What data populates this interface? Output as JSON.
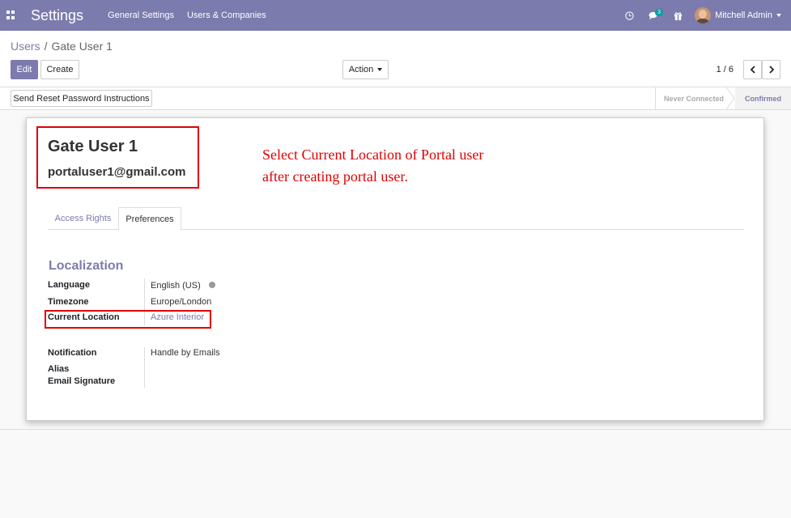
{
  "navbar": {
    "brand": "Settings",
    "menu": [
      "General Settings",
      "Users & Companies"
    ],
    "messages_badge": "3",
    "user_name": "Mitchell Admin"
  },
  "control_panel": {
    "breadcrumb_parent": "Users",
    "breadcrumb_sep": "/",
    "breadcrumb_current": "Gate User 1",
    "edit_label": "Edit",
    "create_label": "Create",
    "action_label": "Action",
    "pager": "1 / 6"
  },
  "statusbar": {
    "reset_password_label": "Send Reset Password Instructions",
    "stages": [
      "Never Connected",
      "Confirmed"
    ],
    "active_stage": "Confirmed"
  },
  "form": {
    "name": "Gate User 1",
    "login": "portaluser1@gmail.com",
    "annotation_line1": "Select Current Location of Portal user",
    "annotation_line2": "after creating portal user.",
    "tabs": [
      "Access Rights",
      "Preferences"
    ],
    "active_tab": "Preferences",
    "section_title": "Localization",
    "fields": {
      "language_label": "Language",
      "language_value": "English (US)",
      "timezone_label": "Timezone",
      "timezone_value": "Europe/London",
      "location_label": "Current Location",
      "location_value": "Azure Interior",
      "notification_label": "Notification",
      "notification_value": "Handle by Emails",
      "alias_label": "Alias",
      "signature_label": "Email Signature"
    }
  },
  "colors": {
    "brand": "#7c7bad",
    "highlight": "#e00000",
    "badge": "#00a09d"
  }
}
